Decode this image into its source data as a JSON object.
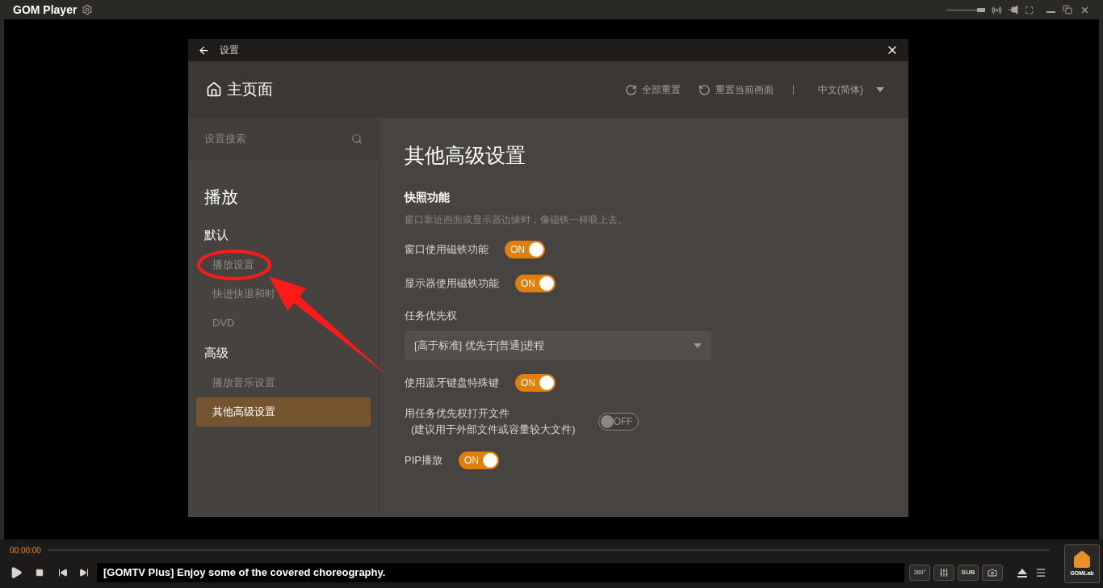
{
  "app": {
    "title": "GOM Player",
    "volume": {
      "level": 1
    }
  },
  "dialog": {
    "title": "设置",
    "home": "主页面",
    "actions": [
      {
        "label": "全部重置",
        "kind": "reset_all"
      },
      {
        "label": "重置当前画面",
        "kind": "reset_current"
      }
    ],
    "language": "中文(简体)",
    "search": {
      "placeholder": "设置搜索"
    },
    "sidebar": {
      "heading": "播放",
      "groups": [
        {
          "label": "默认",
          "items": [
            {
              "label": "播放设置",
              "selected": false
            },
            {
              "label": "快进快退和时",
              "selected": false
            },
            {
              "label": "DVD",
              "selected": false
            }
          ]
        },
        {
          "label": "高级",
          "items": [
            {
              "label": "播放音乐设置",
              "selected": false
            },
            {
              "label": "其他高级设置",
              "selected": true
            }
          ]
        }
      ]
    },
    "content": {
      "title": "其他高级设置",
      "section": "快照功能",
      "description": "窗口靠近画面或显示器边缘时，像磁铁一样吸上去。",
      "settings": [
        {
          "kind": "toggle",
          "label": "窗口使用磁铁功能",
          "on": true,
          "state_text": "ON"
        },
        {
          "kind": "toggle",
          "label": "显示器使用磁铁功能",
          "on": true,
          "state_text": "ON"
        },
        {
          "kind": "label",
          "label": "任务优先权"
        },
        {
          "kind": "dropdown",
          "value": "[高于标准] 优先于[普通]进程"
        },
        {
          "kind": "toggle",
          "label": "使用蓝牙键盘特殊键",
          "on": true,
          "state_text": "ON"
        },
        {
          "kind": "toggle",
          "label": "用任务优先权打开文件",
          "note": "(建议用于外部文件或容量较大文件)",
          "on": false,
          "state_text": "OFF"
        },
        {
          "kind": "toggle",
          "label": "PIP播放",
          "on": true,
          "state_text": "ON"
        }
      ]
    }
  },
  "player": {
    "time": "00:00:00",
    "marquee": "[GOMTV Plus] Enjoy some of the covered choreography.",
    "vr_label": "360°",
    "subtitle_label": "SUB",
    "home_label": "GOMLab"
  }
}
